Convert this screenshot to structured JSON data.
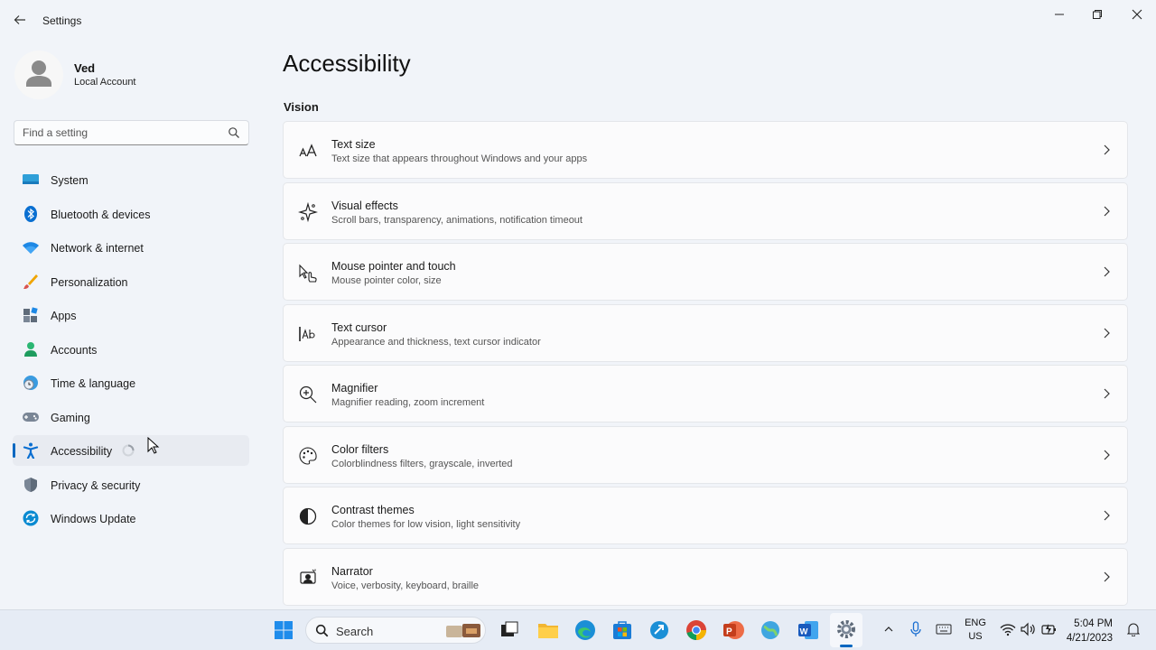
{
  "window": {
    "title": "Settings"
  },
  "profile": {
    "name": "Ved",
    "account_type": "Local Account"
  },
  "search": {
    "placeholder": "Find a setting"
  },
  "sidebar": {
    "items": [
      {
        "label": "System",
        "icon": "system-icon"
      },
      {
        "label": "Bluetooth & devices",
        "icon": "bluetooth-icon"
      },
      {
        "label": "Network & internet",
        "icon": "wifi-icon"
      },
      {
        "label": "Personalization",
        "icon": "brush-icon"
      },
      {
        "label": "Apps",
        "icon": "apps-icon"
      },
      {
        "label": "Accounts",
        "icon": "accounts-icon"
      },
      {
        "label": "Time & language",
        "icon": "clock-globe-icon"
      },
      {
        "label": "Gaming",
        "icon": "gamepad-icon"
      },
      {
        "label": "Accessibility",
        "icon": "accessibility-icon",
        "active": true
      },
      {
        "label": "Privacy & security",
        "icon": "shield-icon"
      },
      {
        "label": "Windows Update",
        "icon": "update-icon"
      }
    ]
  },
  "main": {
    "title": "Accessibility",
    "section": "Vision",
    "cards": [
      {
        "title": "Text size",
        "desc": "Text size that appears throughout Windows and your apps",
        "icon": "text-size-icon"
      },
      {
        "title": "Visual effects",
        "desc": "Scroll bars, transparency, animations, notification timeout",
        "icon": "sparkle-icon"
      },
      {
        "title": "Mouse pointer and touch",
        "desc": "Mouse pointer color, size",
        "icon": "pointer-touch-icon"
      },
      {
        "title": "Text cursor",
        "desc": "Appearance and thickness, text cursor indicator",
        "icon": "text-cursor-icon"
      },
      {
        "title": "Magnifier",
        "desc": "Magnifier reading, zoom increment",
        "icon": "magnifier-icon"
      },
      {
        "title": "Color filters",
        "desc": "Colorblindness filters, grayscale, inverted",
        "icon": "palette-icon"
      },
      {
        "title": "Contrast themes",
        "desc": "Color themes for low vision, light sensitivity",
        "icon": "contrast-icon"
      },
      {
        "title": "Narrator",
        "desc": "Voice, verbosity, keyboard, braille",
        "icon": "narrator-icon"
      }
    ]
  },
  "taskbar": {
    "search_label": "Search",
    "language": "ENG",
    "region": "US",
    "time": "5:04 PM",
    "date": "4/21/2023"
  },
  "colors": {
    "accent": "#0067c0",
    "window_bg": "#f1f4f9",
    "card_bg": "#fbfbfc"
  }
}
